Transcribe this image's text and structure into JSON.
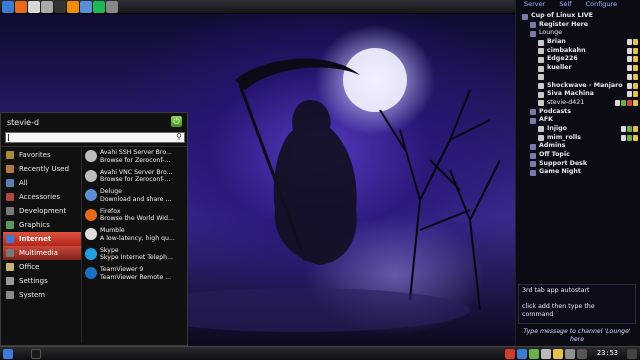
{
  "top_panel": {
    "launchers": [
      {
        "icon": "globe-icon",
        "color": "#3a7bd5"
      },
      {
        "icon": "firefox-icon",
        "color": "#e66a1a"
      },
      {
        "icon": "document-icon",
        "color": "#d7d7d7"
      },
      {
        "icon": "gear-icon",
        "color": "#aaaaaa"
      },
      {
        "icon": "terminal-icon",
        "color": "#333333"
      },
      {
        "icon": "vlc-icon",
        "color": "#f08c0a"
      },
      {
        "icon": "chat-icon",
        "color": "#5a8fd8"
      },
      {
        "icon": "spotify-icon",
        "color": "#1db954"
      },
      {
        "icon": "settings-icon",
        "color": "#888888"
      }
    ]
  },
  "app_menu": {
    "username": "stevie-d",
    "categories": [
      {
        "label": "Favorites",
        "icon": "star-icon",
        "color": "#a8883a",
        "state": "normal"
      },
      {
        "label": "Recently Used",
        "icon": "clock-icon",
        "color": "#b07a4a",
        "state": "normal"
      },
      {
        "label": "All",
        "icon": "grid-icon",
        "color": "#5a7fae",
        "state": "normal"
      },
      {
        "label": "Accessories",
        "icon": "tools-icon",
        "color": "#aa4a3a",
        "state": "normal"
      },
      {
        "label": "Development",
        "icon": "code-icon",
        "color": "#7a7a7a",
        "state": "normal"
      },
      {
        "label": "Graphics",
        "icon": "image-icon",
        "color": "#5a9a5a",
        "state": "normal"
      },
      {
        "label": "Internet",
        "icon": "globe-icon",
        "color": "#3a7bd5",
        "state": "active"
      },
      {
        "label": "Multimedia",
        "icon": "media-icon",
        "color": "#777777",
        "state": "hover"
      },
      {
        "label": "Office",
        "icon": "office-icon",
        "color": "#c8b27a",
        "state": "normal"
      },
      {
        "label": "Settings",
        "icon": "settings-icon",
        "color": "#9a9a9a",
        "state": "normal"
      },
      {
        "label": "System",
        "icon": "system-icon",
        "color": "#8a8a8a",
        "state": "normal"
      }
    ],
    "apps": [
      {
        "name": "Avahi SSH Server Bro...",
        "desc": "Browse for Zeroconf-...",
        "icon": "avahi-icon",
        "color": "#bcbcbc"
      },
      {
        "name": "Avahi VNC Server Bro...",
        "desc": "Browse for Zeroconf-...",
        "icon": "avahi-icon",
        "color": "#bcbcbc"
      },
      {
        "name": "Deluge",
        "desc": "Download and share ...",
        "icon": "deluge-icon",
        "color": "#5a8fd8"
      },
      {
        "name": "Firefox",
        "desc": "Browse the World Wid...",
        "icon": "firefox-icon",
        "color": "#e66a1a"
      },
      {
        "name": "Mumble",
        "desc": "A low-latency, high qu...",
        "icon": "mumble-icon",
        "color": "#dddddd"
      },
      {
        "name": "Skype",
        "desc": "Skype Internet Teleph...",
        "icon": "skype-icon",
        "color": "#1ea0e0"
      },
      {
        "name": "TeamViewer 9",
        "desc": "TeamViewer Remote ...",
        "icon": "teamviewer-icon",
        "color": "#1a6fc4"
      }
    ]
  },
  "chat": {
    "menubar": [
      "Server",
      "Self",
      "Configure"
    ],
    "tree": [
      {
        "label": "Cup of Linux LIVE",
        "indent": 0,
        "icon": "server-icon",
        "bold": true,
        "kind": "channel",
        "flags": []
      },
      {
        "label": "Register Here",
        "indent": 1,
        "icon": "channel-icon",
        "bold": true,
        "kind": "channel",
        "flags": []
      },
      {
        "label": "Lounge",
        "indent": 1,
        "icon": "channel-icon",
        "bold": false,
        "kind": "channel",
        "flags": []
      },
      {
        "label": "Brian",
        "indent": 2,
        "icon": "user-icon",
        "bold": true,
        "kind": "user",
        "flags": [
          "#d9d9d9",
          "#e6c24a"
        ]
      },
      {
        "label": "cimbakahn",
        "indent": 2,
        "icon": "user-icon",
        "bold": true,
        "kind": "user",
        "flags": [
          "#d9d9d9",
          "#e6c24a"
        ]
      },
      {
        "label": "Edge226",
        "indent": 2,
        "icon": "user-icon",
        "bold": true,
        "kind": "user",
        "flags": [
          "#d9d9d9",
          "#e6c24a"
        ]
      },
      {
        "label": "kueller",
        "indent": 2,
        "icon": "user-icon",
        "bold": true,
        "kind": "user",
        "flags": [
          "#d9d9d9",
          "#e6c24a"
        ]
      },
      {
        "label": "",
        "indent": 2,
        "icon": "user-icon",
        "bold": true,
        "kind": "user",
        "flags": [
          "#d9d9d9",
          "#e6c24a"
        ]
      },
      {
        "label": "Shockwave - Manjaro",
        "indent": 2,
        "icon": "user-icon",
        "bold": true,
        "kind": "user",
        "flags": [
          "#d9d9d9",
          "#e6c24a"
        ]
      },
      {
        "label": "Siva Machina",
        "indent": 2,
        "icon": "user-icon",
        "bold": true,
        "kind": "user",
        "flags": [
          "#d9d9d9",
          "#e6c24a"
        ]
      },
      {
        "label": "stevie-d421",
        "indent": 2,
        "icon": "user-icon",
        "bold": false,
        "kind": "user",
        "flags": [
          "#d9d9d9",
          "#6ab04a",
          "#d9443a",
          "#e6c24a"
        ]
      },
      {
        "label": "Podcasts",
        "indent": 1,
        "icon": "channel-icon",
        "bold": true,
        "kind": "channel",
        "flags": []
      },
      {
        "label": "AFK",
        "indent": 1,
        "icon": "channel-icon",
        "bold": true,
        "kind": "channel",
        "flags": []
      },
      {
        "label": "Injigo",
        "indent": 2,
        "icon": "user-icon",
        "bold": true,
        "kind": "user",
        "flags": [
          "#d9d9d9",
          "#6ab04a",
          "#e6c24a"
        ]
      },
      {
        "label": "mim_rolls",
        "indent": 2,
        "icon": "user-icon",
        "bold": true,
        "kind": "user",
        "flags": [
          "#d9d9d9",
          "#6ab04a",
          "#e6c24a"
        ]
      },
      {
        "label": "Admins",
        "indent": 1,
        "icon": "channel-icon",
        "bold": true,
        "kind": "channel",
        "flags": []
      },
      {
        "label": "Off Topic",
        "indent": 1,
        "icon": "channel-icon",
        "bold": true,
        "kind": "channel",
        "flags": []
      },
      {
        "label": "Support Desk",
        "indent": 1,
        "icon": "channel-icon",
        "bold": true,
        "kind": "channel",
        "flags": []
      },
      {
        "label": "Game Night",
        "indent": 1,
        "icon": "channel-icon",
        "bold": true,
        "kind": "channel",
        "flags": []
      }
    ],
    "log": [
      "3rd tab app autostart",
      "",
      "click add then type the",
      "command"
    ],
    "input_placeholder": "Type message to channel 'Lounge' here"
  },
  "taskbar": {
    "clock": "23:53",
    "colors": {
      "accent": "#3a7bd5",
      "menu_active": "#d23a2a"
    }
  }
}
